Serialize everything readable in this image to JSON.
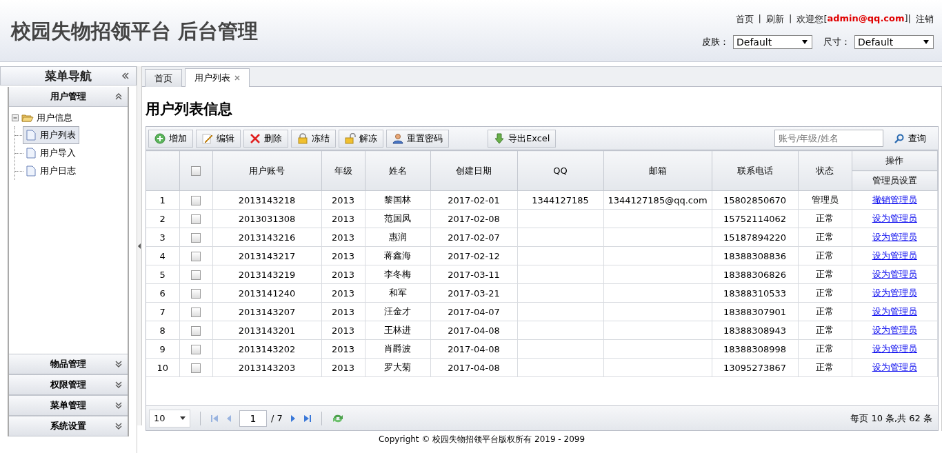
{
  "header": {
    "title": "校园失物招领平台 后台管理",
    "links": [
      {
        "kind": "link",
        "text": "首页"
      },
      {
        "kind": "sep",
        "text": "|"
      },
      {
        "kind": "link",
        "text": "刷新"
      },
      {
        "kind": "sep",
        "text": "|"
      },
      {
        "kind": "text",
        "text": "欢迎您["
      },
      {
        "kind": "user",
        "text": "admin@qq.com"
      },
      {
        "kind": "text",
        "text": "]|"
      },
      {
        "kind": "link",
        "text": "注销"
      }
    ],
    "selects": [
      {
        "label": "皮肤：",
        "value": "Default"
      },
      {
        "label": "尺寸：",
        "value": "Default"
      }
    ]
  },
  "sidebar": {
    "title": "菜单导航",
    "panels": [
      {
        "title": "用户管理",
        "expanded": true,
        "tree": [
          {
            "label": "用户信息",
            "expanded": true,
            "children": [
              {
                "label": "用户列表",
                "selected": true
              },
              {
                "label": "用户导入",
                "selected": false
              },
              {
                "label": "用户日志",
                "selected": false
              }
            ]
          }
        ]
      },
      {
        "title": "物品管理",
        "expanded": false
      },
      {
        "title": "权限管理",
        "expanded": false
      },
      {
        "title": "菜单管理",
        "expanded": false
      },
      {
        "title": "系统设置",
        "expanded": false
      }
    ]
  },
  "tabs": [
    {
      "label": "首页",
      "selected": false,
      "closable": false
    },
    {
      "label": "用户列表",
      "selected": true,
      "closable": true
    }
  ],
  "page_title": "用户列表信息",
  "toolbar": {
    "buttons": [
      {
        "kind": "add",
        "label": "增加"
      },
      {
        "kind": "edit",
        "label": "编辑"
      },
      {
        "kind": "delete",
        "label": "删除"
      },
      {
        "kind": "lock",
        "label": "冻结"
      },
      {
        "kind": "unlock",
        "label": "解冻"
      },
      {
        "kind": "user",
        "label": "重置密码"
      },
      {
        "kind": "export",
        "label": "导出Excel"
      }
    ],
    "search": {
      "placeholder": "账号/年级/姓名",
      "button": "查询"
    }
  },
  "table": {
    "header_checked": false,
    "columns": [
      "用户账号",
      "年级",
      "姓名",
      "创建日期",
      "QQ",
      "邮箱",
      "联系电话",
      "状态"
    ],
    "action_group": "操作",
    "action_column": "管理员设置",
    "rows": [
      {
        "index": "1",
        "checked": false,
        "account": "2013143218",
        "grade": "2013",
        "name": "黎国林",
        "created": "2017-02-01",
        "qq": "1344127185",
        "email": "1344127185@qq.com",
        "phone": "15802850670",
        "status": "管理员",
        "action": "撤销管理员"
      },
      {
        "index": "2",
        "checked": false,
        "account": "2013031308",
        "grade": "2013",
        "name": "范国凤",
        "created": "2017-02-08",
        "phone": "15752114062",
        "status": "正常",
        "action": "设为管理员"
      },
      {
        "index": "3",
        "checked": false,
        "account": "2013143216",
        "grade": "2013",
        "name": "惠润",
        "created": "2017-02-07",
        "phone": "15187894220",
        "status": "正常",
        "action": "设为管理员"
      },
      {
        "index": "4",
        "checked": false,
        "account": "2013143217",
        "grade": "2013",
        "name": "蒋鑫海",
        "created": "2017-02-12",
        "phone": "18388308836",
        "status": "正常",
        "action": "设为管理员"
      },
      {
        "index": "5",
        "checked": false,
        "account": "2013143219",
        "grade": "2013",
        "name": "李冬梅",
        "created": "2017-03-11",
        "phone": "18388306826",
        "status": "正常",
        "action": "设为管理员"
      },
      {
        "index": "6",
        "checked": false,
        "account": "2013141240",
        "grade": "2013",
        "name": "和军",
        "created": "2017-03-21",
        "phone": "18388310533",
        "status": "正常",
        "action": "设为管理员"
      },
      {
        "index": "7",
        "checked": false,
        "account": "2013143207",
        "grade": "2013",
        "name": "汪金才",
        "created": "2017-04-07",
        "phone": "18388307901",
        "status": "正常",
        "action": "设为管理员"
      },
      {
        "index": "8",
        "checked": false,
        "account": "2013143201",
        "grade": "2013",
        "name": "王林进",
        "created": "2017-04-08",
        "phone": "18388308943",
        "status": "正常",
        "action": "设为管理员"
      },
      {
        "index": "9",
        "checked": false,
        "account": "2013143202",
        "grade": "2013",
        "name": "肖爵波",
        "created": "2017-04-08",
        "phone": "18388308998",
        "status": "正常",
        "action": "设为管理员"
      },
      {
        "index": "10",
        "checked": false,
        "account": "2013143203",
        "grade": "2013",
        "name": "罗大菊",
        "created": "2017-04-08",
        "phone": "13095273867",
        "status": "正常",
        "action": "设为管理员"
      }
    ]
  },
  "pager": {
    "page_size": "10",
    "page": "1",
    "total_pages": "/ 7",
    "summary": "每页 10 条,共 62 条"
  },
  "footer": "Copyright © 校园失物招领平台版权所有  2019 - 2099"
}
